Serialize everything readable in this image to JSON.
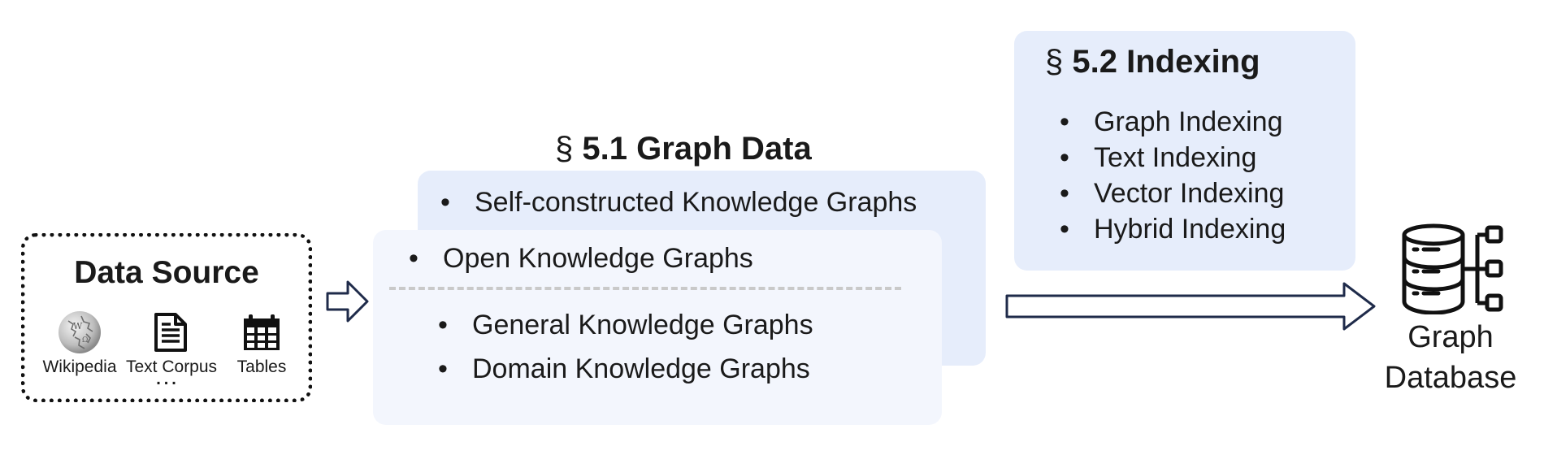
{
  "data_source": {
    "title": "Data Source",
    "items": [
      {
        "label": "Wikipedia",
        "icon": "wikipedia-globe-icon"
      },
      {
        "label": "Text Corpus",
        "icon": "document-icon"
      },
      {
        "label": "Tables",
        "icon": "table-calendar-icon"
      }
    ],
    "more": "…"
  },
  "graph_data": {
    "section_symbol": "§",
    "title": "5.1 Graph Data",
    "back_card": {
      "items": [
        "Self-constructed Knowledge Graphs"
      ]
    },
    "front_card": {
      "header_item": "Open Knowledge Graphs",
      "items": [
        "General Knowledge Graphs",
        "Domain Knowledge Graphs"
      ]
    }
  },
  "indexing": {
    "section_symbol": "§",
    "title": "5.2 Indexing",
    "items": [
      "Graph Indexing",
      "Text Indexing",
      "Vector Indexing",
      "Hybrid Indexing"
    ]
  },
  "graph_database": {
    "label_line1": "Graph",
    "label_line2": "Database",
    "icon": "database-graph-icon"
  },
  "bullet_char": "•",
  "colors": {
    "card_back": "#e6edfb",
    "card_front": "#f3f6fd",
    "arrow_stroke": "#1f2b4a",
    "text": "#1a1a1a"
  }
}
